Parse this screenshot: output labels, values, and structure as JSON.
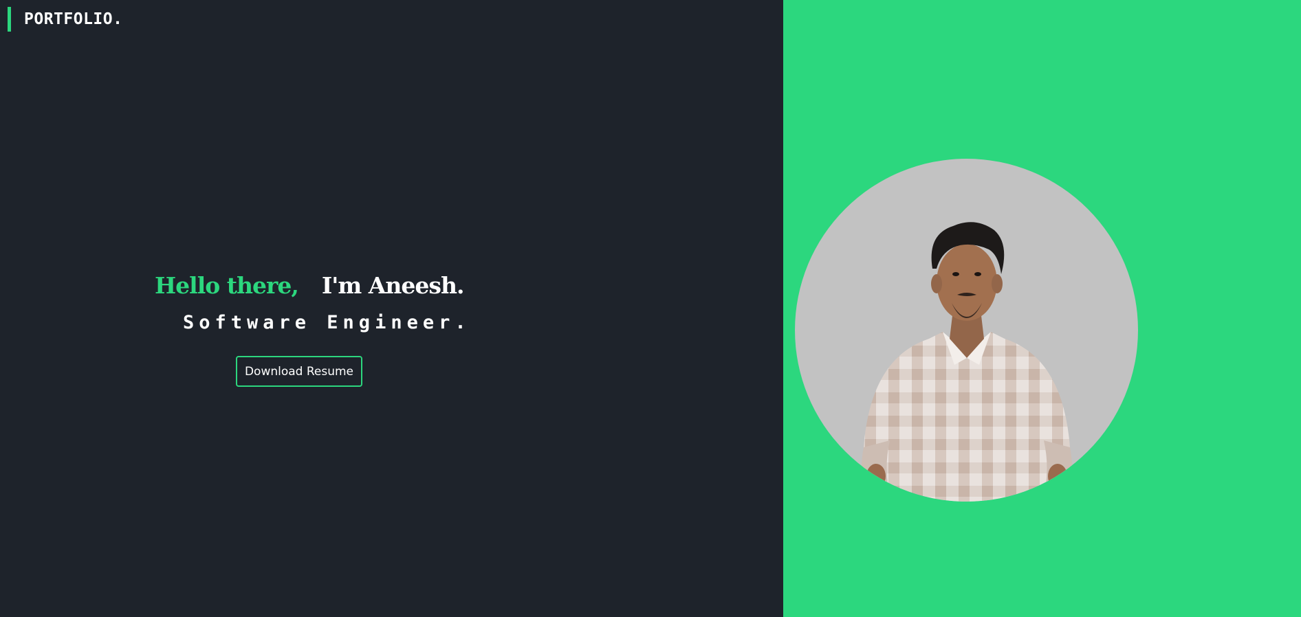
{
  "header": {
    "logo_text": "PORTFOLIO."
  },
  "hero": {
    "greeting_highlight": "Hello there,",
    "greeting_name": "I'm Aneesh.",
    "role": "Software Engineer.",
    "download_label": "Download Resume"
  },
  "colors": {
    "accent": "#2cd77e",
    "left_background": "#1e232b",
    "photo_background": "#c2c2c2"
  },
  "profile_photo": {
    "icon": "person-portrait"
  }
}
